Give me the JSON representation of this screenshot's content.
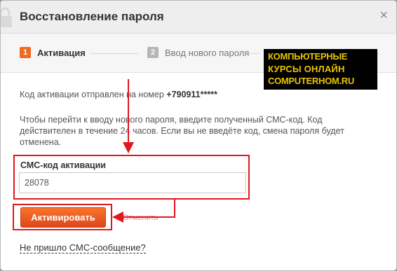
{
  "dialog": {
    "title": "Восстановление пароля",
    "close_label": "×"
  },
  "steps": [
    {
      "number": "1",
      "label": "Активация",
      "active": true
    },
    {
      "number": "2",
      "label": "Ввод нового пароля",
      "active": false
    }
  ],
  "body": {
    "sent_text": "Код активации отправлен на номер",
    "phone": "+790911*****",
    "instructions": "Чтобы перейти к вводу нового пароля, введите полученный СМС-код. Код действителен в течение 24 часов. Если вы не введёте код, смена пароля будет отменена.",
    "field_label": "СМС-код активации",
    "field_value": "28078",
    "activate_button": "Активировать",
    "cancel_link": "Отменить",
    "no_sms_link": "Не пришло СМС-сообщение?"
  },
  "watermark": {
    "line1": "КОМПЬЮТЕРНЫЕ",
    "line2": "КУРСЫ ОНЛАЙН",
    "line3": "COMPUTERHOM.RU"
  },
  "colors": {
    "accent": "#f26a21",
    "annotation": "#e2161f",
    "watermark_text": "#e8c400"
  }
}
